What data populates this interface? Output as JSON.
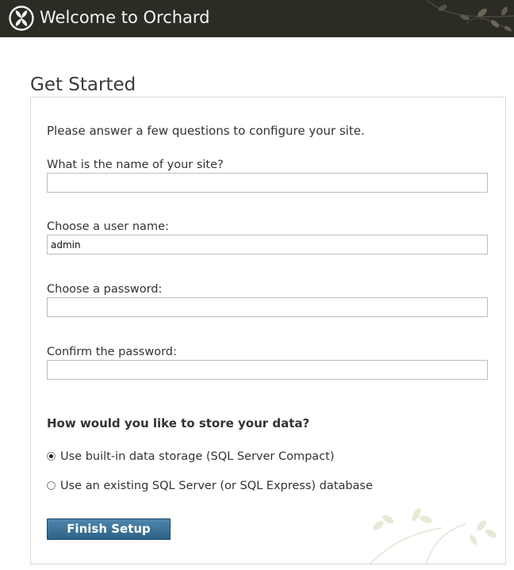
{
  "header": {
    "title": "Welcome to Orchard",
    "logo_icon": "orchard-logo-icon",
    "background_color": "#2c2b24"
  },
  "page": {
    "title": "Get Started",
    "intro": "Please answer a few questions to configure your site."
  },
  "form": {
    "site_name": {
      "label": "What is the name of your site?",
      "value": ""
    },
    "user_name": {
      "label": "Choose a user name:",
      "value": "admin"
    },
    "password": {
      "label": "Choose a password:",
      "value": ""
    },
    "confirm_password": {
      "label": "Confirm the password:",
      "value": ""
    },
    "storage": {
      "heading": "How would you like to store your data?",
      "options": [
        {
          "label": "Use built-in data storage (SQL Server Compact)",
          "selected": true
        },
        {
          "label": "Use an existing SQL Server (or SQL Express) database",
          "selected": false
        }
      ]
    },
    "submit_label": "Finish Setup"
  },
  "colors": {
    "accent_button": "#3a6f95",
    "panel_border": "#d8d8d8"
  }
}
